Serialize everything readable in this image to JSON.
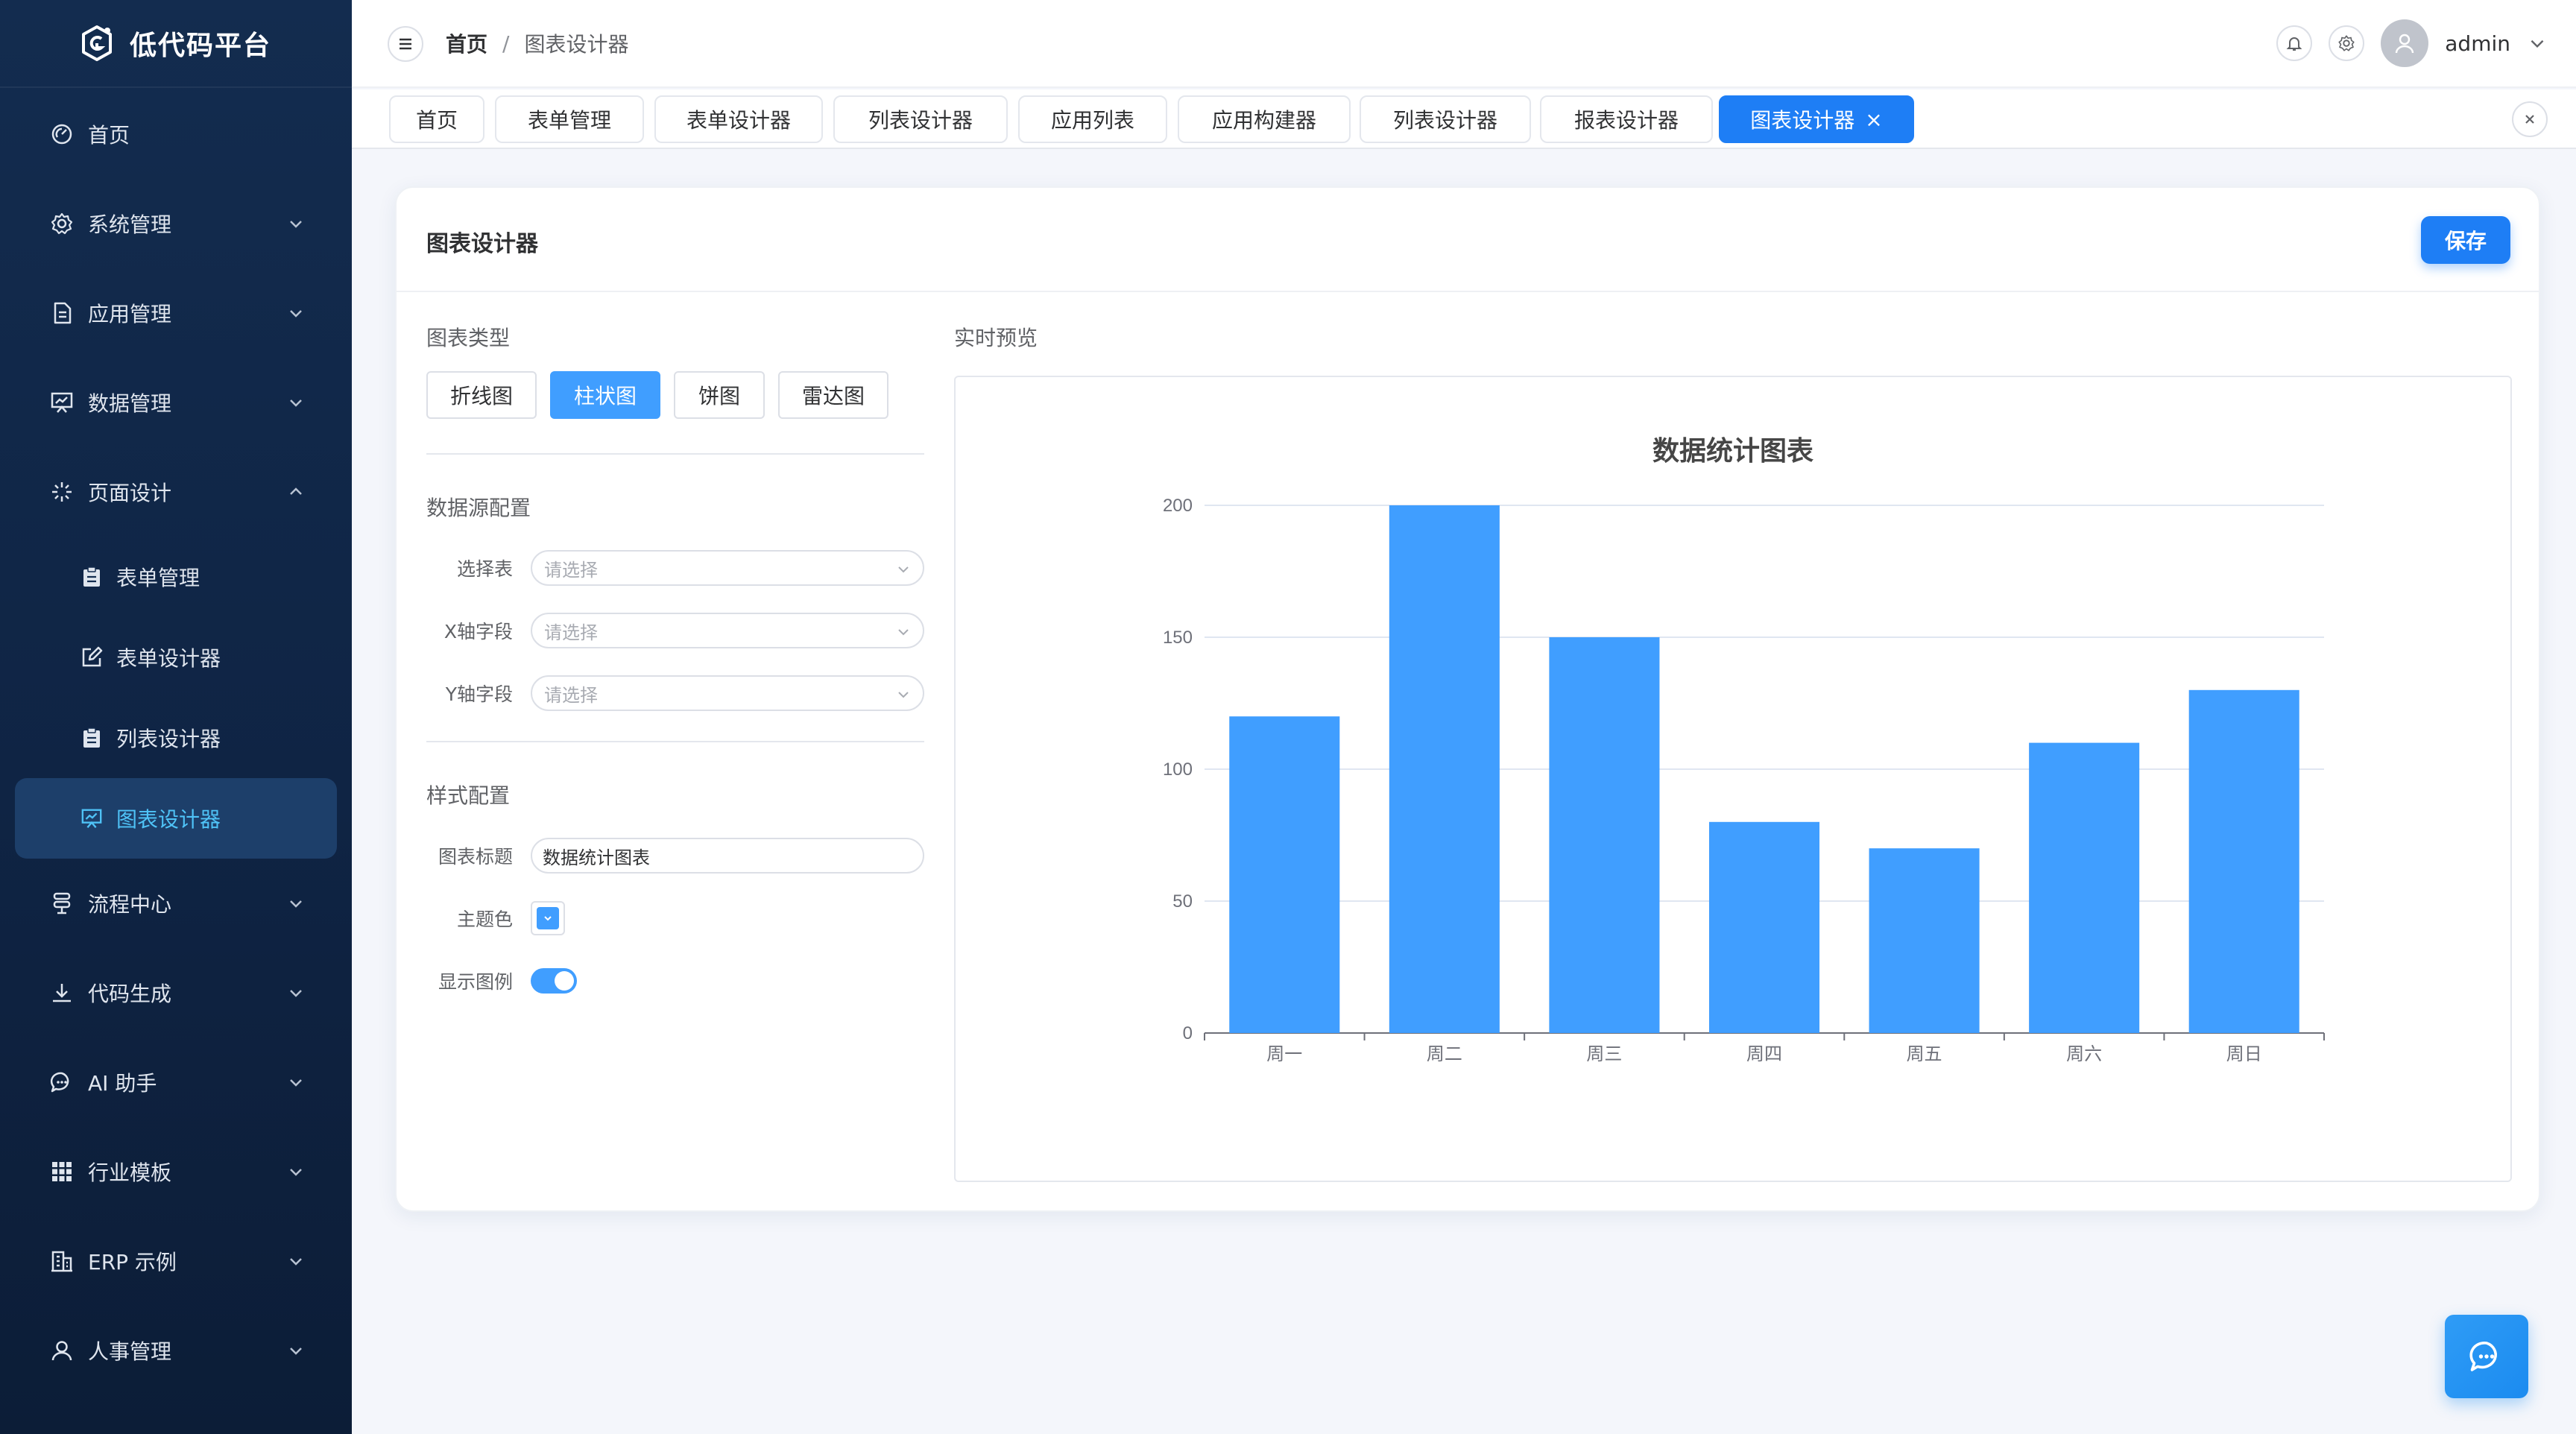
{
  "app": {
    "logo_text": "低代码平台"
  },
  "sidebar": {
    "items": [
      {
        "label": "首页",
        "icon": "dashboard-icon"
      },
      {
        "label": "系统管理",
        "icon": "gear-icon"
      },
      {
        "label": "应用管理",
        "icon": "document-icon"
      },
      {
        "label": "数据管理",
        "icon": "chart-board-icon"
      },
      {
        "label": "页面设计",
        "icon": "sparkle-icon",
        "expanded": true
      }
    ],
    "sub_items": [
      {
        "label": "表单管理",
        "icon": "clipboard-icon"
      },
      {
        "label": "表单设计器",
        "icon": "edit-icon"
      },
      {
        "label": "列表设计器",
        "icon": "clipboard-icon"
      },
      {
        "label": "图表设计器",
        "icon": "chart-board-icon",
        "active": true
      }
    ],
    "items_after": [
      {
        "label": "流程中心",
        "icon": "flow-icon"
      },
      {
        "label": "代码生成",
        "icon": "download-icon"
      },
      {
        "label": "AI 助手",
        "icon": "chat-icon"
      },
      {
        "label": "行业模板",
        "icon": "grid-icon"
      },
      {
        "label": "ERP 示例",
        "icon": "building-icon"
      },
      {
        "label": "人事管理",
        "icon": "user-icon"
      }
    ]
  },
  "header": {
    "breadcrumb": [
      "首页",
      "图表设计器"
    ],
    "breadcrumb_sep": "/",
    "username": "admin"
  },
  "tabs": [
    "首页",
    "表单管理",
    "表单设计器",
    "列表设计器",
    "应用列表",
    "应用构建器",
    "列表设计器",
    "报表设计器",
    "图表设计器"
  ],
  "active_tab_index": 8,
  "tab_close_glyph": "×",
  "card": {
    "title": "图表设计器",
    "save_label": "保存",
    "chart_type_title": "图表类型",
    "chart_types": [
      "折线图",
      "柱状图",
      "饼图",
      "雷达图"
    ],
    "active_chart_type_index": 1,
    "datasource_title": "数据源配置",
    "fields": [
      {
        "label": "选择表",
        "placeholder": "请选择"
      },
      {
        "label": "X轴字段",
        "placeholder": "请选择"
      },
      {
        "label": "Y轴字段",
        "placeholder": "请选择"
      }
    ],
    "style_title": "样式配置",
    "chart_title_label": "图表标题",
    "chart_title_value": "数据统计图表",
    "theme_color_label": "主题色",
    "theme_color": "#409eff",
    "show_legend_label": "显示图例",
    "show_legend": true,
    "preview_title": "实时预览"
  },
  "colors": {
    "accent": "#1e7ef5",
    "bar": "#409eff",
    "sidebar_bg": "#0f2444",
    "active_text": "#4fc3f7"
  },
  "chart_data": {
    "type": "bar",
    "title": "数据统计图表",
    "categories": [
      "周一",
      "周二",
      "周三",
      "周四",
      "周五",
      "周六",
      "周日"
    ],
    "values": [
      120,
      200,
      150,
      80,
      70,
      110,
      130
    ],
    "ylim": [
      0,
      200
    ],
    "yticks": [
      0,
      50,
      100,
      150,
      200
    ],
    "grid": true,
    "xlabel": "",
    "ylabel": ""
  }
}
